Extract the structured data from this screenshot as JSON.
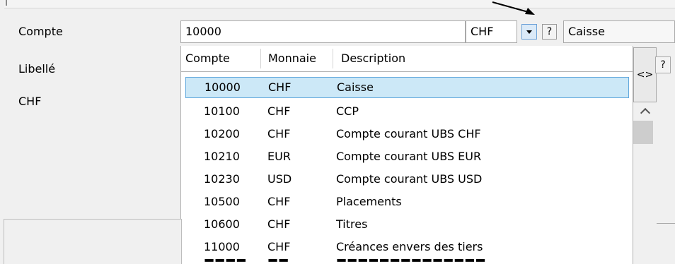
{
  "form": {
    "compte_label": "Compte",
    "libelle_label": "Libellé",
    "chf_label": "CHF",
    "compte_value": "10000",
    "currency_value": "CHF",
    "help_label": "?",
    "description_value": "Caisse"
  },
  "dropdown": {
    "headers": {
      "account": "Compte",
      "currency": "Monnaie",
      "description": "Description"
    },
    "rows": [
      {
        "account": "10000",
        "currency": "CHF",
        "description": "Caisse"
      },
      {
        "account": "10100",
        "currency": "CHF",
        "description": "CCP"
      },
      {
        "account": "10200",
        "currency": "CHF",
        "description": "Compte courant UBS CHF"
      },
      {
        "account": "10210",
        "currency": "EUR",
        "description": "Compte courant UBS EUR"
      },
      {
        "account": "10230",
        "currency": "USD",
        "description": "Compte courant UBS USD"
      },
      {
        "account": "10500",
        "currency": "CHF",
        "description": "Placements"
      },
      {
        "account": "10600",
        "currency": "CHF",
        "description": "Titres"
      },
      {
        "account": "11000",
        "currency": "CHF",
        "description": "Créances envers des tiers"
      }
    ],
    "selected_index": 0,
    "swap_label": "<>",
    "swap_help_label": "?"
  },
  "colors": {
    "selection_bg": "#cce8f7",
    "selection_border": "#62a9dd",
    "dropdown_button_bg": "#dbeaf8"
  },
  "icons": {
    "dropdown": "triangle-down-icon",
    "scroll_up": "chevron-up-icon",
    "annotation": "arrow-icon"
  }
}
